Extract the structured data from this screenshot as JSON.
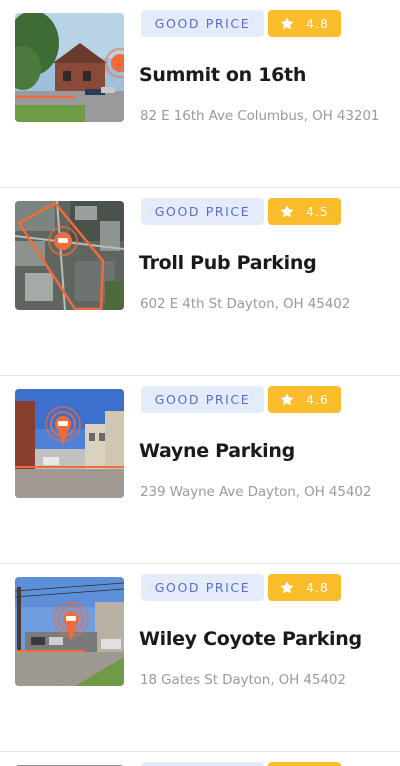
{
  "listings": [
    {
      "price_badge": "GOOD PRICE",
      "rating": "4.8",
      "name": "Summit on 16th",
      "address": "82 E 16th Ave Columbus, OH 43201"
    },
    {
      "price_badge": "GOOD PRICE",
      "rating": "4.5",
      "name": "Troll Pub Parking",
      "address": "602 E 4th St Dayton, OH 45402"
    },
    {
      "price_badge": "GOOD PRICE",
      "rating": "4.6",
      "name": "Wayne Parking",
      "address": "239 Wayne Ave Dayton, OH 45402"
    },
    {
      "price_badge": "GOOD PRICE",
      "rating": "4.8",
      "name": "Wiley Coyote Parking",
      "address": "18 Gates St Dayton, OH 45402"
    }
  ],
  "colors": {
    "price_badge_bg": "#e4ecfc",
    "price_badge_text": "#5b6cd0",
    "rating_badge_bg": "#fbbc2c",
    "pin_accent": "#f26b3a",
    "divider": "#e6e6ea"
  },
  "icons": {
    "rating": "star-icon",
    "map_marker": "parking-pin-icon"
  }
}
